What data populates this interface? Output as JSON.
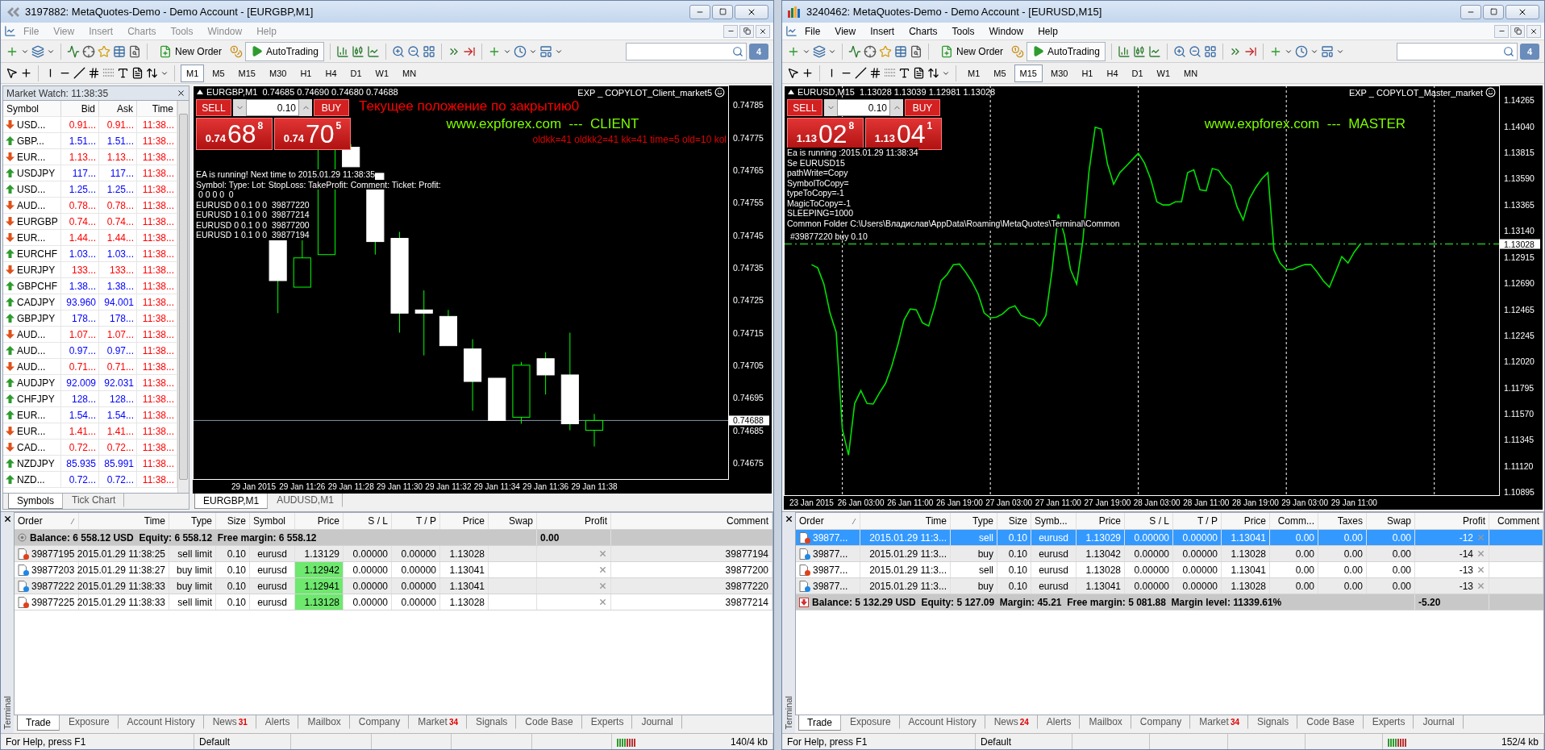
{
  "windows": [
    {
      "title": "3197882: MetaQuotes-Demo - Demo Account - [EURGBP,M1]",
      "active": false,
      "menu": [
        "File",
        "View",
        "Insert",
        "Charts",
        "Tools",
        "Window",
        "Help"
      ],
      "toolbar": {
        "new_order": "New Order",
        "auto_trading": "AutoTrading",
        "messages": "4"
      },
      "timeframes": [
        {
          "label": "M1",
          "selected": true
        },
        {
          "label": "M5",
          "selected": false
        },
        {
          "label": "M15",
          "selected": false
        },
        {
          "label": "M30",
          "selected": false
        },
        {
          "label": "H1",
          "selected": false
        },
        {
          "label": "H4",
          "selected": false
        },
        {
          "label": "D1",
          "selected": false
        },
        {
          "label": "W1",
          "selected": false
        },
        {
          "label": "MN",
          "selected": false
        }
      ],
      "market_watch": {
        "title": "Market Watch: 11:38:35",
        "columns": [
          "Symbol",
          "Bid",
          "Ask",
          "Time"
        ],
        "rows": [
          {
            "symbol": "USD...",
            "bid": "0.91...",
            "ask": "0.91...",
            "time": "11:38...",
            "rising": false
          },
          {
            "symbol": "GBP...",
            "bid": "1.51...",
            "ask": "1.51...",
            "time": "11:38...",
            "rising": true
          },
          {
            "symbol": "EUR...",
            "bid": "1.13...",
            "ask": "1.13...",
            "time": "11:38...",
            "rising": false
          },
          {
            "symbol": "USDJPY",
            "bid": "117...",
            "ask": "117...",
            "time": "11:38...",
            "rising": true
          },
          {
            "symbol": "USD...",
            "bid": "1.25...",
            "ask": "1.25...",
            "time": "11:38...",
            "rising": true
          },
          {
            "symbol": "AUD...",
            "bid": "0.78...",
            "ask": "0.78...",
            "time": "11:38...",
            "rising": false
          },
          {
            "symbol": "EURGBP",
            "bid": "0.74...",
            "ask": "0.74...",
            "time": "11:38...",
            "rising": false
          },
          {
            "symbol": "EUR...",
            "bid": "1.44...",
            "ask": "1.44...",
            "time": "11:38...",
            "rising": false
          },
          {
            "symbol": "EURCHF",
            "bid": "1.03...",
            "ask": "1.03...",
            "time": "11:38...",
            "rising": true
          },
          {
            "symbol": "EURJPY",
            "bid": "133...",
            "ask": "133...",
            "time": "11:38...",
            "rising": false
          },
          {
            "symbol": "GBPCHF",
            "bid": "1.38...",
            "ask": "1.38...",
            "time": "11:38...",
            "rising": true
          },
          {
            "symbol": "CADJPY",
            "bid": "93.960",
            "ask": "94.001",
            "time": "11:38...",
            "rising": true
          },
          {
            "symbol": "GBPJPY",
            "bid": "178...",
            "ask": "178...",
            "time": "11:38...",
            "rising": true
          },
          {
            "symbol": "AUD...",
            "bid": "1.07...",
            "ask": "1.07...",
            "time": "11:38...",
            "rising": false
          },
          {
            "symbol": "AUD...",
            "bid": "0.97...",
            "ask": "0.97...",
            "time": "11:38...",
            "rising": true
          },
          {
            "symbol": "AUD...",
            "bid": "0.71...",
            "ask": "0.71...",
            "time": "11:38...",
            "rising": false
          },
          {
            "symbol": "AUDJPY",
            "bid": "92.009",
            "ask": "92.031",
            "time": "11:38...",
            "rising": true
          },
          {
            "symbol": "CHFJPY",
            "bid": "128...",
            "ask": "128...",
            "time": "11:38...",
            "rising": true
          },
          {
            "symbol": "EUR...",
            "bid": "1.54...",
            "ask": "1.54...",
            "time": "11:38...",
            "rising": true
          },
          {
            "symbol": "EUR...",
            "bid": "1.41...",
            "ask": "1.41...",
            "time": "11:38...",
            "rising": false
          },
          {
            "symbol": "CAD...",
            "bid": "0.72...",
            "ask": "0.72...",
            "time": "11:38...",
            "rising": false
          },
          {
            "symbol": "NZDJPY",
            "bid": "85.935",
            "ask": "85.991",
            "time": "11:38...",
            "rising": true
          },
          {
            "symbol": "NZD...",
            "bid": "0.72...",
            "ask": "0.72...",
            "time": "11:38...",
            "rising": true
          }
        ],
        "tabs": [
          {
            "label": "Symbols",
            "selected": true
          },
          {
            "label": "Tick Chart",
            "selected": false
          }
        ]
      },
      "chart": {
        "symbol_line": "EURGBP,M1  0.74685 0.74690 0.74680 0.74688",
        "expert": "EXP _ COPYLOT_Client_market5",
        "price_tag": "0.74688",
        "period_separators": false,
        "panel": {
          "sell": "SELL",
          "buy": "BUY",
          "lot": "0.10",
          "bid": {
            "prefix": "0.74",
            "big": "68",
            "small": "8"
          },
          "ask": {
            "prefix": "0.74",
            "big": "70",
            "small": "5"
          }
        },
        "notes": [
          {
            "text": "Текущее положение по закрытию0",
            "color": "#ff0000"
          },
          {
            "text": "www.expforex.com  ---  CLIENT",
            "color": "#7cfc00"
          },
          {
            "text": "oldkk=41 oldkk2=41 kk=41 time=5 old=10 kol",
            "color": "#e00000"
          }
        ],
        "info_lines": [
          "EA is running! Next time to 2015.01.29 11:38:35",
          "Symbol: Type: Lot: StopLoss: TakeProfit: Comment: Ticket: Profit:",
          " 0 0 0 0  0",
          "EURUSD 0 0.1 0 0  39877220",
          "EURUSD 1 0.1 0 0  39877214",
          "EURUSD 0 0.1 0 0  39877200",
          "EURUSD 1 0.1 0 0  39877194"
        ],
        "price_scale": [
          "0.74785",
          "0.74775",
          "0.74765",
          "0.74755",
          "0.74745",
          "0.74735",
          "0.74725",
          "0.74715",
          "0.74705",
          "0.74695",
          "0.74685",
          "0.74675"
        ],
        "time_scale": [
          "29 Jan 2015",
          "29 Jan 11:26",
          "29 Jan 11:28",
          "29 Jan 11:30",
          "29 Jan 11:32",
          "29 Jan 11:34",
          "29 Jan 11:36",
          "29 Jan 11:38"
        ]
      },
      "chart_tabs": [
        {
          "label": "EURGBP,M1",
          "selected": true
        },
        {
          "label": "AUDUSD,M1",
          "selected": false
        }
      ],
      "terminal": {
        "side_label": "Terminal",
        "columns": [
          {
            "kind": "order",
            "label": "Order"
          },
          {
            "kind": "time",
            "label": "Time"
          },
          {
            "kind": "type",
            "label": "Type"
          },
          {
            "kind": "size",
            "label": "Size"
          },
          {
            "kind": "symbol",
            "label": "Symbol"
          },
          {
            "kind": "price",
            "label": "Price"
          },
          {
            "kind": "number",
            "label": "S / L"
          },
          {
            "kind": "number",
            "label": "T / P"
          },
          {
            "kind": "number",
            "label": "Price"
          },
          {
            "kind": "number",
            "label": "Swap"
          },
          {
            "kind": "profit",
            "label": "Profit"
          },
          {
            "kind": "comment",
            "label": "Comment"
          }
        ],
        "rows": [
          {
            "kind": "balance",
            "text": "Balance: 6 558.12 USD  Equity: 6 558.12  Free margin: 6 558.12",
            "profit": "0.00"
          },
          {
            "kind": "order",
            "selected": false,
            "color": "#e0401a",
            "price_highlight": false,
            "cells": [
              "39877195",
              "2015.01.29 11:38:25",
              "sell limit",
              "0.10",
              "eurusd",
              "1.13129",
              "0.00000",
              "0.00000",
              "1.13028",
              null,
              null,
              "39877194"
            ]
          },
          {
            "kind": "order",
            "selected": false,
            "color": "#1e88e5",
            "price_highlight": true,
            "cells": [
              "39877203",
              "2015.01.29 11:38:27",
              "buy limit",
              "0.10",
              "eurusd",
              "1.12942",
              "0.00000",
              "0.00000",
              "1.13041",
              null,
              null,
              "39877200"
            ]
          },
          {
            "kind": "order",
            "selected": false,
            "color": "#1e88e5",
            "price_highlight": true,
            "cells": [
              "39877222",
              "2015.01.29 11:38:33",
              "buy limit",
              "0.10",
              "eurusd",
              "1.12941",
              "0.00000",
              "0.00000",
              "1.13041",
              null,
              null,
              "39877220"
            ]
          },
          {
            "kind": "order",
            "selected": false,
            "color": "#e0401a",
            "price_highlight": true,
            "cells": [
              "39877225",
              "2015.01.29 11:38:33",
              "sell limit",
              "0.10",
              "eurusd",
              "1.13128",
              "0.00000",
              "0.00000",
              "1.13028",
              null,
              null,
              "39877214"
            ]
          }
        ],
        "tabs": [
          {
            "label": "Trade",
            "selected": true
          },
          {
            "label": "Exposure",
            "selected": false
          },
          {
            "label": "Account History",
            "selected": false
          },
          {
            "label": "News",
            "badge": "31",
            "selected": false
          },
          {
            "label": "Alerts",
            "selected": false
          },
          {
            "label": "Mailbox",
            "selected": false
          },
          {
            "label": "Company",
            "selected": false
          },
          {
            "label": "Market",
            "badge": "34",
            "selected": false
          },
          {
            "label": "Signals",
            "selected": false
          },
          {
            "label": "Code Base",
            "selected": false
          },
          {
            "label": "Experts",
            "selected": false
          },
          {
            "label": "Journal",
            "selected": false
          }
        ]
      },
      "status_bar": {
        "help": "For Help, press F1",
        "profile": "Default",
        "traffic": "140/4 kb"
      }
    },
    {
      "title": "3240462: MetaQuotes-Demo - Demo Account - [EURUSD,M15]",
      "active": true,
      "menu": [
        "File",
        "View",
        "Insert",
        "Charts",
        "Tools",
        "Window",
        "Help"
      ],
      "toolbar": {
        "new_order": "New Order",
        "auto_trading": "AutoTrading",
        "messages": "4"
      },
      "timeframes": [
        {
          "label": "M1",
          "selected": false
        },
        {
          "label": "M5",
          "selected": false
        },
        {
          "label": "M15",
          "selected": true
        },
        {
          "label": "M30",
          "selected": false
        },
        {
          "label": "H1",
          "selected": false
        },
        {
          "label": "H4",
          "selected": false
        },
        {
          "label": "D1",
          "selected": false
        },
        {
          "label": "W1",
          "selected": false
        },
        {
          "label": "MN",
          "selected": false
        }
      ],
      "chart": {
        "symbol_line": "EURUSD,M15  1.13028 1.13039 1.12981 1.13028",
        "expert": "EXP _ COPYLOT_Master_market",
        "price_tag": "1.13028",
        "period_separators": true,
        "panel": {
          "sell": "SELL",
          "buy": "BUY",
          "lot": "0.10",
          "bid": {
            "prefix": "1.13",
            "big": "02",
            "small": "8"
          },
          "ask": {
            "prefix": "1.13",
            "big": "04",
            "small": "1"
          }
        },
        "notes": [
          {
            "text": "www.expforex.com  ---  MASTER",
            "color": "#7cfc00"
          }
        ],
        "info_lines": [
          "Ea is running :2015.01.29 11:38:34",
          "Se EURUSD15",
          "pathWrite=Copy",
          "SymbolToCopy=",
          "typeToCopy=-1",
          "MagicToCopy=-1",
          "SLEEPING=1000",
          "Common Folder C:\\Users\\Владислав\\AppData\\Roaming\\MetaQuotes\\Terminal\\Common"
        ],
        "chart_data": {
          "type": "line",
          "ylim": [
            1.1087,
            1.1439
          ],
          "categories": [
            null,
            null,
            null,
            null,
            "23 Jan 2015",
            null,
            null,
            null,
            null,
            null,
            null,
            null,
            "26 Jan 03:00",
            null,
            null,
            null,
            null,
            null,
            null,
            null,
            "26 Jan 11:00",
            null,
            null,
            null,
            null,
            null,
            null,
            null,
            "26 Jan 19:00",
            null,
            null,
            null,
            null,
            null,
            null,
            null,
            "27 Jan 03:00",
            null,
            null,
            null,
            null,
            null,
            null,
            null,
            "27 Jan 11:00",
            null,
            null,
            null,
            null,
            null,
            null,
            null,
            "27 Jan 19:00",
            null,
            null,
            null,
            null,
            null,
            null,
            null,
            "28 Jan 03:00",
            null,
            null,
            null,
            null,
            null,
            null,
            null,
            "28 Jan 11:00",
            null,
            null,
            null,
            null,
            null,
            null,
            null,
            "28 Jan 19:00",
            null,
            null,
            null,
            null,
            null,
            null,
            null,
            "29 Jan 03:00",
            null,
            null,
            null,
            null,
            null,
            null,
            null,
            "29 Jan 11:00",
            null,
            null,
            null,
            null,
            null,
            null,
            null,
            null,
            null,
            null,
            null,
            null,
            null,
            null,
            null,
            null,
            null,
            null,
            null,
            null,
            null,
            null,
            null
          ],
          "series": [
            {
              "color": "#00e000",
              "values": [
                null,
                null,
                null,
                null,
                1.12851,
                1.12823,
                1.12684,
                1.12435,
                1.12268,
                1.11436,
                1.11214,
                1.11658,
                1.11769,
                1.11658,
                1.11653,
                1.11748,
                1.11831,
                1.11977,
                1.12164,
                1.12375,
                1.1247,
                1.12462,
                1.12351,
                1.12324,
                1.12497,
                1.12712,
                1.12767,
                1.1285,
                1.12856,
                1.12785,
                1.12705,
                1.12601,
                1.12435,
                1.12393,
                1.124,
                1.12428,
                1.12477,
                1.12497,
                1.12414,
                1.12393,
                1.12379,
                1.12324,
                1.12414,
                1.12795,
                1.13283,
                1.13108,
                1.12809,
                1.12684,
                1.13058,
                1.13651,
                1.14032,
                1.14016,
                1.13716,
                1.13541,
                1.13641,
                1.13696,
                1.13752,
                1.13807,
                1.13724,
                1.13586,
                1.13391,
                1.13364,
                1.13364,
                1.13391,
                1.13391,
                1.13641,
                1.13666,
                1.13495,
                1.13486,
                1.13676,
                1.13662,
                1.13585,
                1.1353,
                1.1335,
                1.13235,
                1.13415,
                1.1351,
                1.13586,
                1.13641,
                1.12975,
                1.12864,
                1.12809,
                1.12809,
                1.12833,
                1.12851,
                1.12851,
                1.12788,
                1.12712,
                1.12657,
                1.12788,
                1.1292,
                1.12865,
                1.12958,
                1.13028,
                null,
                null,
                null,
                null,
                null,
                null,
                null,
                null,
                null,
                null,
                null,
                null,
                null,
                null,
                null,
                null,
                null,
                null,
                null,
                null,
                null,
                null
              ]
            }
          ],
          "yticks": [
            1.14265,
            {
              "value": 1.1404,
              "label": "1.14040"
            },
            1.13815,
            {
              "value": 1.1359,
              "label": "1.13590"
            },
            1.13365,
            {
              "value": 1.1314,
              "label": "1.13140"
            },
            1.12915,
            {
              "value": 1.1269,
              "label": "1.12690"
            },
            1.12465,
            1.12245,
            {
              "value": 1.1202,
              "label": "1.12020"
            },
            1.11795,
            {
              "value": 1.1157,
              "label": "1.11570"
            },
            1.11345,
            {
              "value": 1.1112,
              "label": "1.11120"
            },
            1.10895
          ],
          "ref_lines": [
            {
              "axis": "y",
              "value": 1.13028,
              "label": "#39877220 buy 0.10"
            }
          ]
        }
      },
      "terminal": {
        "side_label": "Terminal",
        "columns": [
          {
            "kind": "order",
            "label": "Order"
          },
          {
            "kind": "time",
            "label": "Time"
          },
          {
            "kind": "type",
            "label": "Type"
          },
          {
            "kind": "size",
            "label": "Size"
          },
          {
            "kind": "symbol",
            "label": "Symb..."
          },
          {
            "kind": "price",
            "label": "Price"
          },
          {
            "kind": "number",
            "label": "S / L"
          },
          {
            "kind": "number",
            "label": "T / P"
          },
          {
            "kind": "number",
            "label": "Price"
          },
          {
            "kind": "number",
            "label": "Comm..."
          },
          {
            "kind": "number",
            "label": "Taxes"
          },
          {
            "kind": "number",
            "label": "Swap"
          },
          {
            "kind": "profit",
            "label": "Profit"
          },
          {
            "kind": "comment",
            "label": "Comment"
          }
        ],
        "rows": [
          {
            "kind": "order",
            "selected": true,
            "color": "#e0401a",
            "cells": [
              "39877...",
              "2015.01.29 11:3...",
              "sell",
              "0.10",
              "eurusd",
              "1.13029",
              "0.00000",
              "0.00000",
              "1.13041",
              "0.00",
              "0.00",
              "0.00",
              "-12",
              null
            ]
          },
          {
            "kind": "order",
            "selected": false,
            "color": "#1e88e5",
            "cells": [
              "39877...",
              "2015.01.29 11:3...",
              "buy",
              "0.10",
              "eurusd",
              "1.13042",
              "0.00000",
              "0.00000",
              "1.13028",
              "0.00",
              "0.00",
              "0.00",
              "-14",
              null
            ]
          },
          {
            "kind": "order",
            "selected": false,
            "color": "#e0401a",
            "cells": [
              "39877...",
              "2015.01.29 11:3...",
              "sell",
              "0.10",
              "eurusd",
              "1.13028",
              "0.00000",
              "0.00000",
              "1.13041",
              "0.00",
              "0.00",
              "0.00",
              "-13",
              null
            ]
          },
          {
            "kind": "order",
            "selected": false,
            "color": "#1e88e5",
            "cells": [
              "39877...",
              "2015.01.29 11:3...",
              "buy",
              "0.10",
              "eurusd",
              "1.13041",
              "0.00000",
              "0.00000",
              "1.13028",
              "0.00",
              "0.00",
              "0.00",
              "-13",
              null
            ]
          },
          {
            "kind": "drawdown",
            "text": "Balance: 5 132.29 USD  Equity: 5 127.09  Margin: 45.21  Free margin: 5 081.88  Margin level: 11339.61%",
            "profit": "-5.20"
          }
        ],
        "tabs": [
          {
            "label": "Trade",
            "selected": true
          },
          {
            "label": "Exposure",
            "selected": false
          },
          {
            "label": "Account History",
            "selected": false
          },
          {
            "label": "News",
            "badge": "24",
            "selected": false
          },
          {
            "label": "Alerts",
            "selected": false
          },
          {
            "label": "Mailbox",
            "selected": false
          },
          {
            "label": "Company",
            "selected": false
          },
          {
            "label": "Market",
            "badge": "34",
            "selected": false
          },
          {
            "label": "Signals",
            "selected": false
          },
          {
            "label": "Code Base",
            "selected": false
          },
          {
            "label": "Experts",
            "selected": false
          },
          {
            "label": "Journal",
            "selected": false
          }
        ]
      },
      "status_bar": {
        "help": "For Help, press F1",
        "profile": "Default",
        "traffic": "152/4 kb"
      }
    }
  ]
}
